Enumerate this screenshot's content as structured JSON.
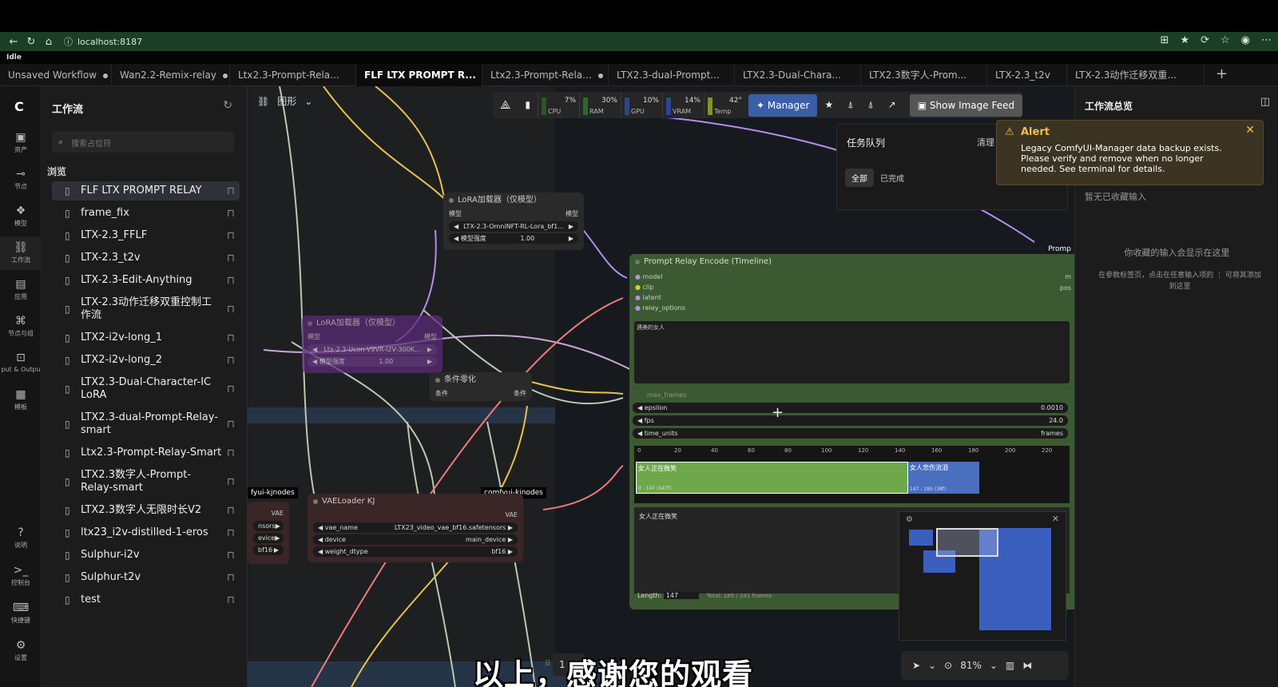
{
  "browser": {
    "url": "localhost:8187"
  },
  "status": "Idle",
  "tabs": [
    {
      "label": "Unsaved Workflow",
      "dot": true,
      "w": 140
    },
    {
      "label": "Wan2.2-Remix-relay",
      "dot": true,
      "w": 148
    },
    {
      "label": "Ltx2.3-Prompt-Rela...",
      "dot": false,
      "w": 158
    },
    {
      "label": "FLF LTX PROMPT R...",
      "dot": true,
      "w": 158,
      "active": true
    },
    {
      "label": "Ltx2.3-Prompt-Rela...",
      "dot": true,
      "w": 158
    },
    {
      "label": "LTX2.3-dual-Prompt...",
      "dot": false,
      "w": 158
    },
    {
      "label": "LTX2.3-Dual-Chara...",
      "dot": false,
      "w": 158
    },
    {
      "label": "LTX2.3数字人-Prom...",
      "dot": false,
      "w": 158
    },
    {
      "label": "LTX-2.3_t2v",
      "dot": false,
      "w": 100
    },
    {
      "label": "LTX-2.3动作迁移双重...",
      "dot": false,
      "w": 172
    }
  ],
  "rail": [
    {
      "label": "资产",
      "icon": "image-icon"
    },
    {
      "label": "节点",
      "icon": "node-icon"
    },
    {
      "label": "模型",
      "icon": "model-icon"
    },
    {
      "label": "工作流",
      "icon": "workflow-icon",
      "active": true
    },
    {
      "label": "应用",
      "icon": "app-icon"
    },
    {
      "label": "节点与组",
      "icon": "node-group-icon"
    },
    {
      "label": "put & Outpu",
      "icon": "io-icon"
    },
    {
      "label": "模板",
      "icon": "template-icon"
    }
  ],
  "rail_bottom": [
    {
      "label": "说明",
      "icon": "help-icon"
    },
    {
      "label": "控制台",
      "icon": "console-icon"
    },
    {
      "label": "快捷键",
      "icon": "keyboard-icon"
    },
    {
      "label": "设置",
      "icon": "settings-icon"
    }
  ],
  "sidebar": {
    "title": "工作流",
    "search_placeholder": "搜索占位符",
    "browse": "浏览",
    "items": [
      "FLF LTX PROMPT RELAY",
      "frame_fix",
      "LTX-2.3_FFLF",
      "LTX-2.3_t2v",
      "LTX-2.3-Edit-Anything",
      "LTX-2.3动作迁移双重控制工作流",
      "LTX2-i2v-long_1",
      "LTX2-i2v-long_2",
      "LTX2.3-Dual-Character-IC LoRA",
      "LTX2.3-dual-Prompt-Relay-smart",
      "Ltx2.3-Prompt-Relay-Smart",
      "LTX2.3数字人-Prompt-Relay-smart",
      "LTX2.3数字人无限时长V2",
      "ltx23_i2v-distilled-1-eros",
      "Sulphur-i2v",
      "Sulphur-t2v",
      "test"
    ]
  },
  "toolbar": {
    "graph_label": "图形",
    "meters": [
      {
        "name": "CPU",
        "pct": "7%",
        "color": "#2d7a2d",
        "level": 0.07
      },
      {
        "name": "RAM",
        "pct": "30%",
        "color": "#2d7a2d",
        "level": 0.3
      },
      {
        "name": "GPU",
        "pct": "10%",
        "color": "#2d5bd8",
        "level": 0.1
      },
      {
        "name": "VRAM",
        "pct": "14%",
        "color": "#2d5bd8",
        "level": 0.14
      },
      {
        "name": "Temp",
        "pct": "42°",
        "color": "#88a020",
        "level": 0.42
      }
    ],
    "manager": "Manager",
    "show_feed": "Show Image Feed"
  },
  "queue": {
    "title": "任务队列",
    "clear": "清理",
    "all": "全部",
    "done": "已完成"
  },
  "alert": {
    "title": "Alert",
    "message": "Legacy ComfyUI-Manager data backup exists. Please verify and remove when no longer needed. See terminal for details."
  },
  "right_panel": {
    "title": "工作流总览",
    "empty1": "暂无已收藏输入",
    "empty2": "你收藏的输入会显示在这里",
    "empty3": "在参数标签页，点击在任意输入项的 ⋮ 可将其添加到这里"
  },
  "nodes": {
    "lora1": {
      "title": "LoRA加载器（仅模型）",
      "in": "模型",
      "out": "模型",
      "lora": "LTX-2.3-OmniNFT-RL-Lora_bf1...",
      "strength_label": "模型强度",
      "strength": "1.00"
    },
    "lora2": {
      "title": "LoRA加载器（仅模型）",
      "in": "模型",
      "out": "模型",
      "lora": "Ltx-2.3-Ucon-V9VR-I2V-300K...",
      "strength_label": "模型强度",
      "strength": "1.00"
    },
    "cond": {
      "title": "条件零化",
      "in": "条件",
      "out": "条件"
    },
    "vae": {
      "title": "VAELoader KJ",
      "out": "VAE",
      "vae_name_label": "vae_name",
      "vae_name": "LTX23_video_vae_bf16.safetensors",
      "device_label": "device",
      "device": "main_device",
      "dtype_label": "weight_dtype",
      "dtype": "bf16",
      "tag": "comfyui-kjnodes"
    },
    "left_partial": {
      "tag": "fyui-kjnodes",
      "out": "VAE",
      "r1": "nsors",
      "r2": "evice",
      "r3": "bf16"
    },
    "relay": {
      "title": "Prompt Relay Encode (Timeline)",
      "inputs": [
        "model",
        "clip",
        "latent",
        "relay_options"
      ],
      "right_in": "m",
      "right_pos": "pos",
      "prompt_text": "遇美的女人",
      "max_frames": "max_frames",
      "epsilon_label": "epsilon",
      "epsilon": "0.0010",
      "fps_label": "fps",
      "fps": "24.0",
      "time_units_label": "time_units",
      "time_units": "frames",
      "ticks": [
        "0",
        "20",
        "40",
        "60",
        "80",
        "100",
        "120",
        "140",
        "160",
        "180",
        "200",
        "220"
      ],
      "seg1_label": "女人正在微笑",
      "seg1_sub": "0 - 147 (147f)",
      "seg2_label": "女人悲伤流泪",
      "seg2_sub": "147 - 185 (38f)",
      "edit_text": "女人正在微笑",
      "length_label": "Length:",
      "length": "147",
      "total": "Total: 185 / 241 frames",
      "out_label": "Promp"
    }
  },
  "bottom": {
    "page": "1",
    "zoom": "81%"
  },
  "subtitle": "以上，感谢您的观看"
}
